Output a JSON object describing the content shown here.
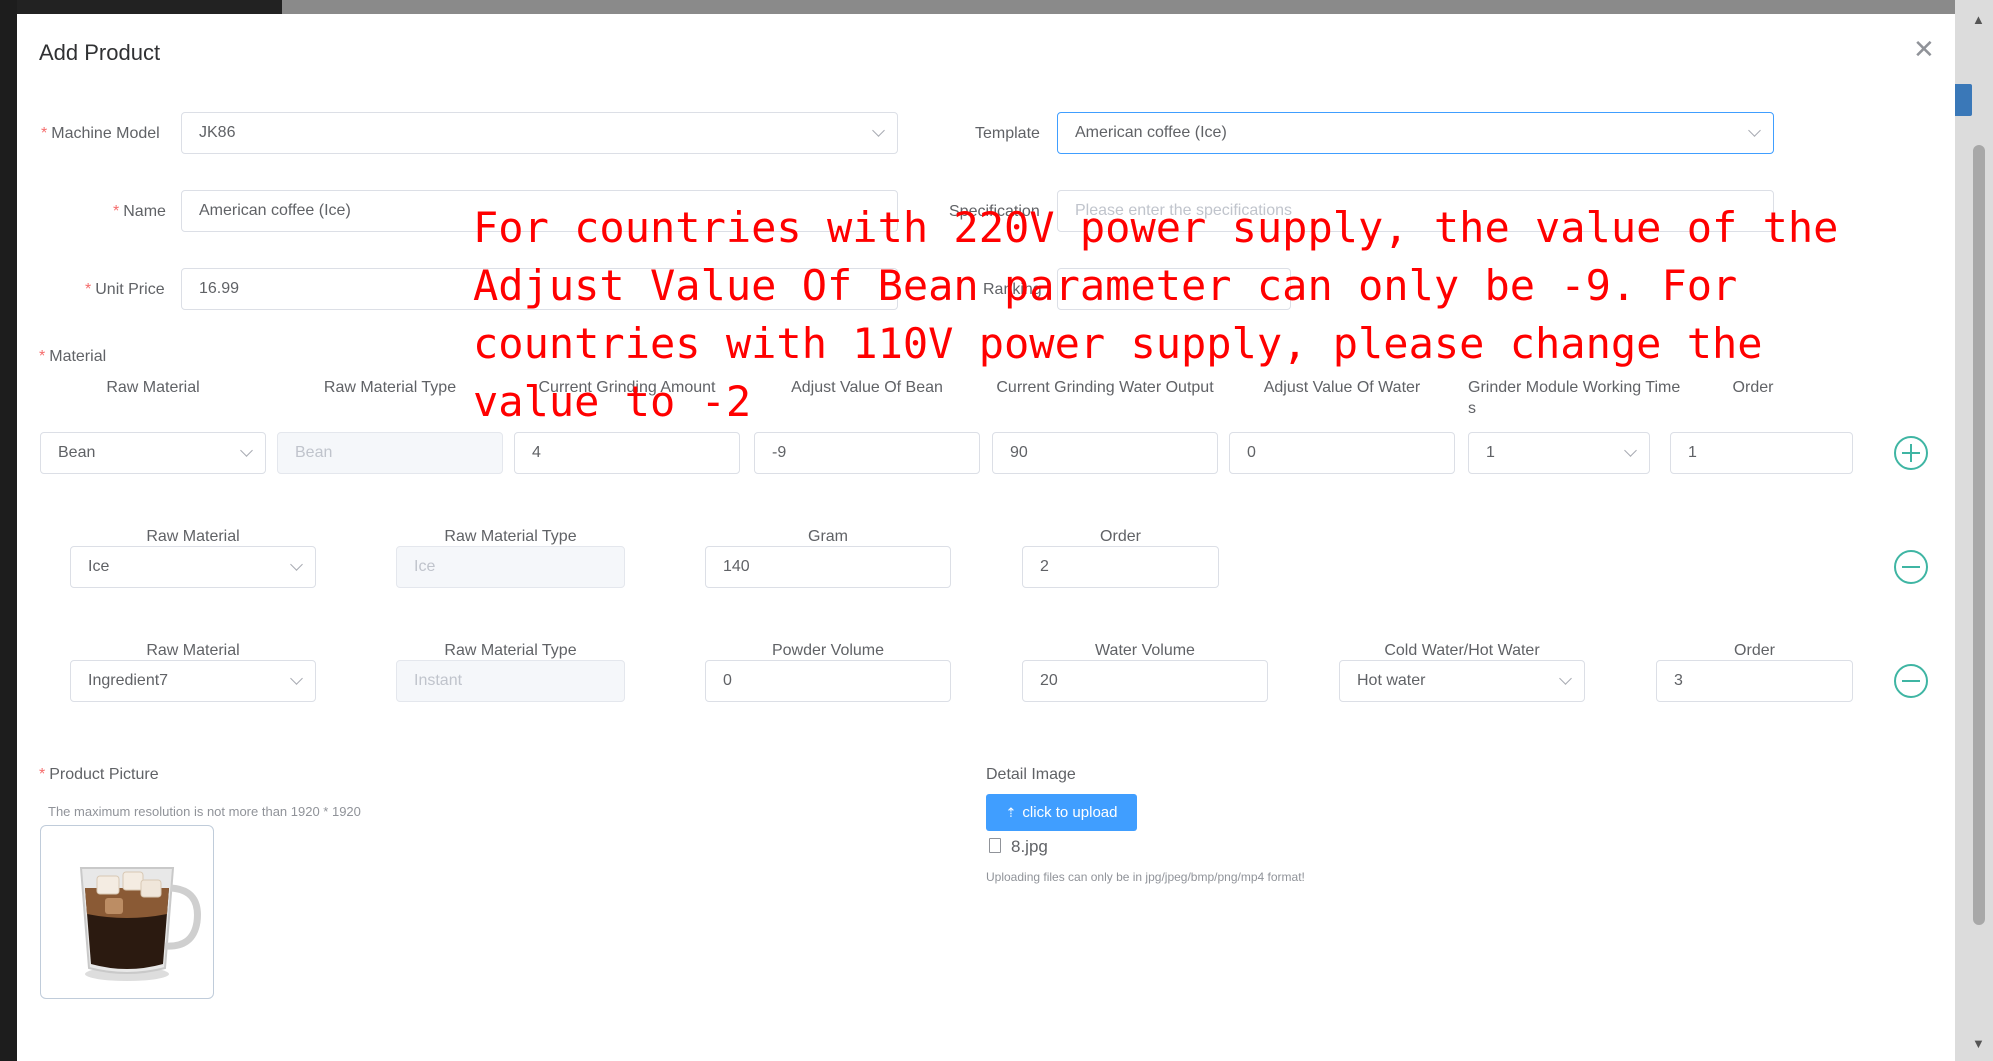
{
  "dialog": {
    "title": "Add Product"
  },
  "form": {
    "machine_model": {
      "label": "Machine Model",
      "value": "JK86"
    },
    "template": {
      "label": "Template",
      "value": "American coffee  (Ice)"
    },
    "name": {
      "label": "Name",
      "value": "American coffee  (Ice)"
    },
    "specification": {
      "label": "Specification",
      "placeholder": "Please enter the specifications"
    },
    "unit_price": {
      "label": "Unit Price",
      "value": "16.99"
    },
    "ranking": {
      "label": "Ranking"
    },
    "material_label": "Material",
    "product_picture_label": "Product Picture",
    "picture_hint": "The maximum resolution is not more than 1920 * 1920",
    "detail_image_label": "Detail Image",
    "upload_button": "click to upload",
    "uploaded_file": "8.jpg",
    "upload_hint": "Uploading files can only be in jpg/jpeg/bmp/png/mp4 format!"
  },
  "materials": {
    "bean_row": {
      "headers": [
        "Raw Material",
        "Raw Material Type",
        "Current Grinding Amount",
        "Adjust Value Of Bean",
        "Current Grinding Water Output",
        "Adjust Value Of Water",
        "Grinder Module Working Time",
        "s",
        "Order"
      ],
      "raw_material": "Bean",
      "raw_material_type": "Bean",
      "grinding_amount": "4",
      "adjust_bean": "-9",
      "grinding_water": "90",
      "adjust_water": "0",
      "working_time": "1",
      "order": "1"
    },
    "ice_row": {
      "headers": [
        "Raw Material",
        "Raw Material Type",
        "Gram",
        "Order"
      ],
      "raw_material": "Ice",
      "raw_material_type": "Ice",
      "gram": "140",
      "order": "2"
    },
    "ingredient_row": {
      "headers": [
        "Raw Material",
        "Raw Material Type",
        "Powder Volume",
        "Water Volume",
        "Cold Water/Hot Water",
        "Order"
      ],
      "raw_material": "Ingredient7",
      "raw_material_type": "Instant",
      "powder_volume": "0",
      "water_volume": "20",
      "water_temp": "Hot water",
      "order": "3"
    }
  },
  "annotation": {
    "text": "For countries with 220V power supply, the value of the\nAdjust Value Of Bean parameter can only be -9. For\ncountries with 110V power supply, please change the\nvalue to -2",
    "color": "#ff0000"
  },
  "colors": {
    "primary": "#409eff",
    "teal": "#3fb5a3",
    "required": "#f56c6c"
  },
  "icons": [
    "close-icon",
    "chevron-down-icon",
    "plus-circle-icon",
    "minus-circle-icon",
    "upload-icon",
    "document-icon",
    "scroll-arrow-icon"
  ]
}
